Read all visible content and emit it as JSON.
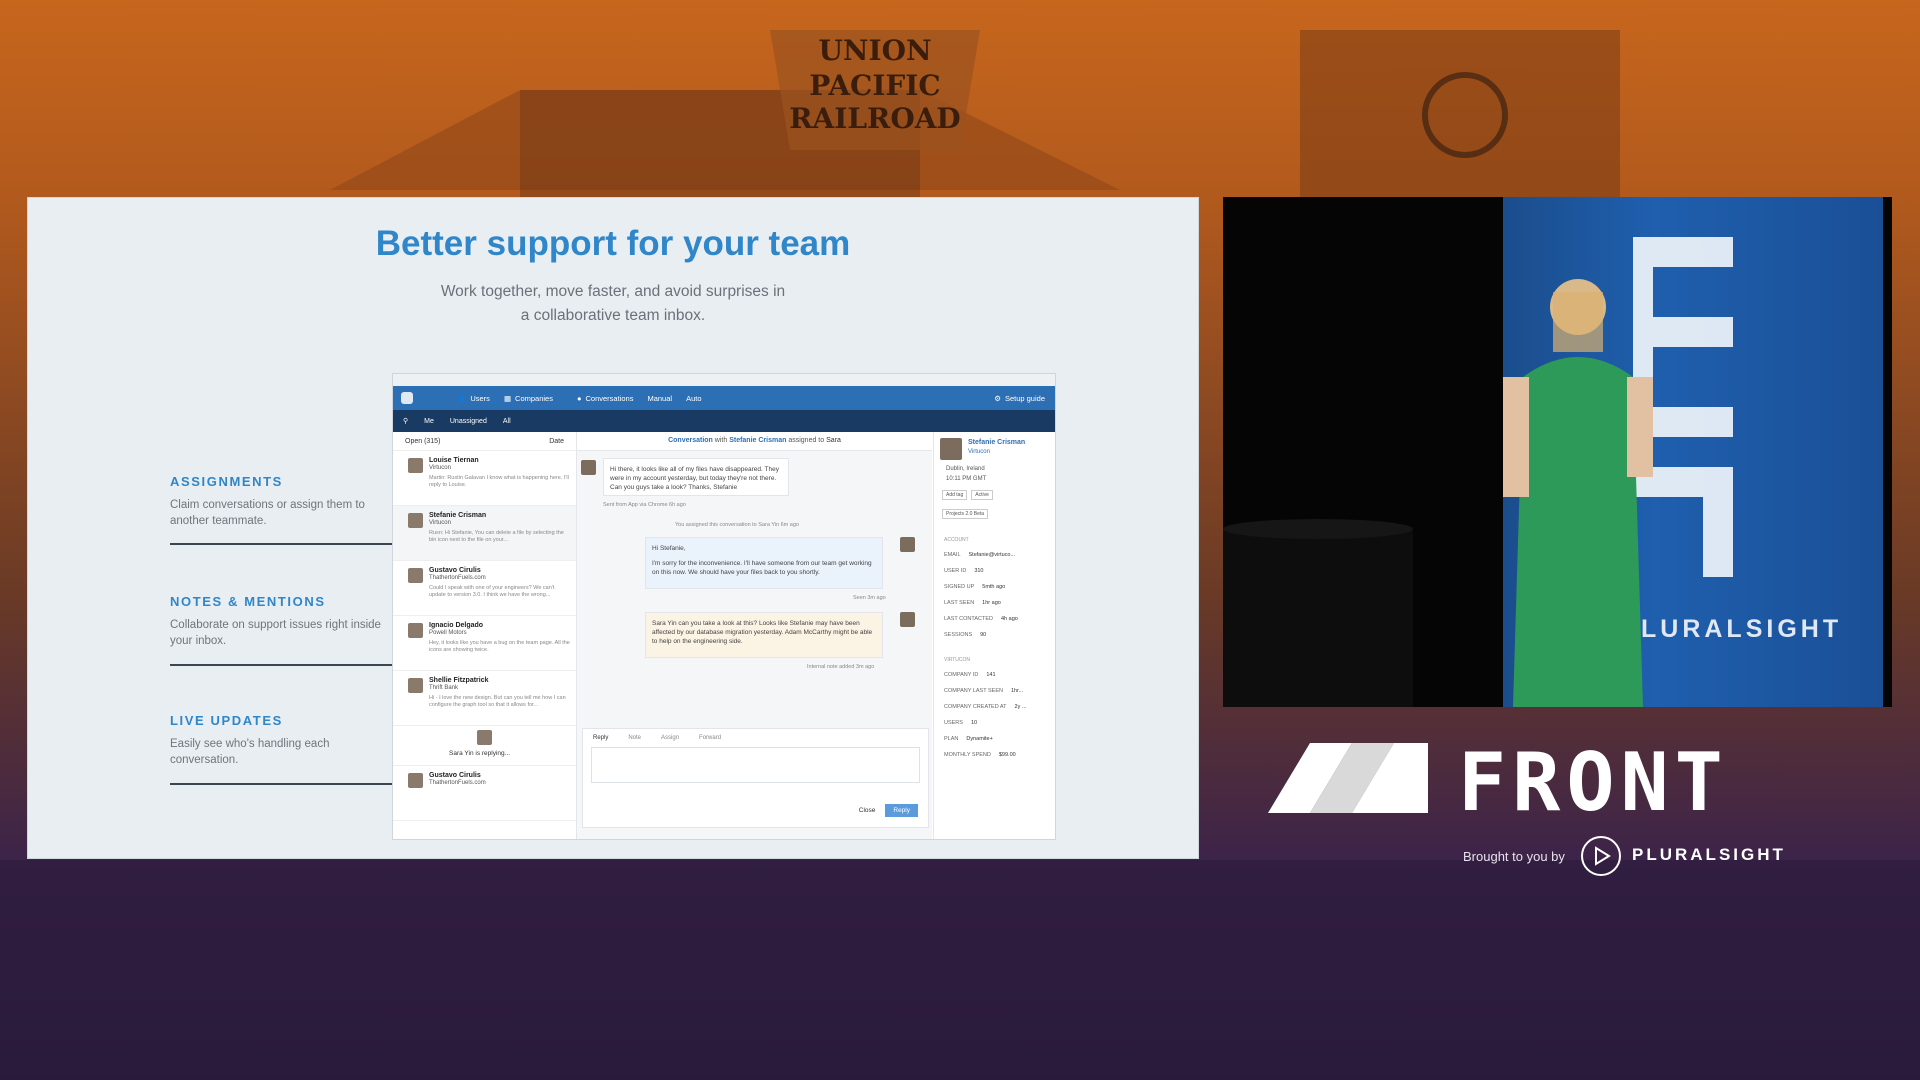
{
  "background": {
    "sign_lines": [
      "UNION",
      "PACIFIC",
      "RAILROAD"
    ]
  },
  "slide": {
    "title": "Better support for your team",
    "subtitle_lines": [
      "Work together, move faster, and avoid surprises in",
      "a collaborative team inbox."
    ],
    "features": [
      {
        "heading": "ASSIGNMENTS",
        "desc": "Claim conversations or assign them to another teammate."
      },
      {
        "heading": "NOTES & MENTIONS",
        "desc": "Collaborate on support issues right inside your inbox."
      },
      {
        "heading": "LIVE UPDATES",
        "desc": "Easily see who's handling each conversation."
      }
    ]
  },
  "app": {
    "topbar": {
      "users": "Users",
      "companies": "Companies",
      "conversations": "Conversations",
      "manual": "Manual",
      "auto": "Auto",
      "setup": "Setup guide"
    },
    "subbar": {
      "me": "Me",
      "unassigned": "Unassigned",
      "all": "All"
    },
    "list_filter": {
      "open": "Open (315)",
      "sort": "Date"
    },
    "conversations": [
      {
        "name": "Louise Tiernan",
        "company": "Virtucon",
        "preview": "Martin: Rustin Galavan I know what is happening here. I'll reply to Louise."
      },
      {
        "name": "Stefanie Crisman",
        "company": "Virtucon",
        "preview": "Rusn: Hi Stefanie, You can delete a file by selecting the bin icon next to the file on your..."
      },
      {
        "name": "Gustavo Cirulis",
        "company": "ThathertonFuels.com",
        "preview": "Could I speak with one of your engineers? We can't update to version 3.0. I think we have the wrong..."
      },
      {
        "name": "Ignacio Delgado",
        "company": "Powell Motors",
        "preview": "Hey, it looks like you have a bug on the team page. All the icons are showing twice."
      },
      {
        "name": "Shellie Fitzpatrick",
        "company": "Thrift Bank",
        "preview": "Hi - I love the new design. But can you tell me how I can configure the graph tool so that it allows for..."
      },
      {
        "name": "Gustavo Cirulis",
        "company": "ThathertonFuels.com",
        "preview": ""
      }
    ],
    "replying": "Sara Yin is replying...",
    "conv_header": {
      "prefix": "Conversation",
      "with": "with",
      "name": "Stefanie Crisman",
      "assigned": "assigned to",
      "assignee": "Sara"
    },
    "messages": {
      "m1": "Hi there, it looks like all of my files have disappeared. They were in my account yesterday, but today they're not there. Can you guys take a look? Thanks, Stefanie",
      "m1_meta": "Sent from App via Chrome 6h ago",
      "assign_event": "You assigned this conversation to Sara Yin 6m ago",
      "m2_greet": "Hi Stefanie,",
      "m2": "I'm sorry for the inconvenience. I'll have someone from our team get working on this now. We should have your files back to you shortly.",
      "m2_meta": "Seen 3m ago",
      "note": "Sara Yin can you take a look at this? Looks like Stefanie may have been affected by our database migration yesterday. Adam McCarthy might be able to help on the engineering side.",
      "note_meta": "Internal note added 3m ago"
    },
    "reply_tabs": [
      "Reply",
      "Note",
      "Assign",
      "Forward"
    ],
    "reply_buttons": {
      "close": "Close",
      "reply": "Reply"
    },
    "profile": {
      "name": "Stefanie Crisman",
      "company": "Virtucon",
      "location": "Dublin, Ireland",
      "time": "10:11 PM GMT",
      "tags": [
        "Add tag",
        "Active",
        "Projects 2.0 Beta"
      ],
      "account_label": "ACCOUNT",
      "attrs": [
        {
          "k": "EMAIL",
          "v": "Stefanie@virtuco..."
        },
        {
          "k": "USER ID",
          "v": "310"
        },
        {
          "k": "SIGNED UP",
          "v": "5mth ago"
        },
        {
          "k": "LAST SEEN",
          "v": "1hr ago"
        },
        {
          "k": "LAST CONTACTED",
          "v": "4h ago"
        },
        {
          "k": "SESSIONS",
          "v": "90"
        }
      ],
      "company_label": "VIRTUCON",
      "company_attrs": [
        {
          "k": "COMPANY ID",
          "v": "141"
        },
        {
          "k": "COMPANY LAST SEEN",
          "v": "1hr..."
        },
        {
          "k": "COMPANY CREATED AT",
          "v": "2y ..."
        },
        {
          "k": "USERS",
          "v": "10"
        },
        {
          "k": "PLAN",
          "v": "Dynamite+"
        },
        {
          "k": "MONTHLY SPEND",
          "v": "$99.00"
        }
      ]
    }
  },
  "video": {
    "banner_text": "LURALSIGHT"
  },
  "branding": {
    "event": "FRONT",
    "brought_by": "Brought to you by",
    "sponsor": "PLURALSIGHT"
  }
}
